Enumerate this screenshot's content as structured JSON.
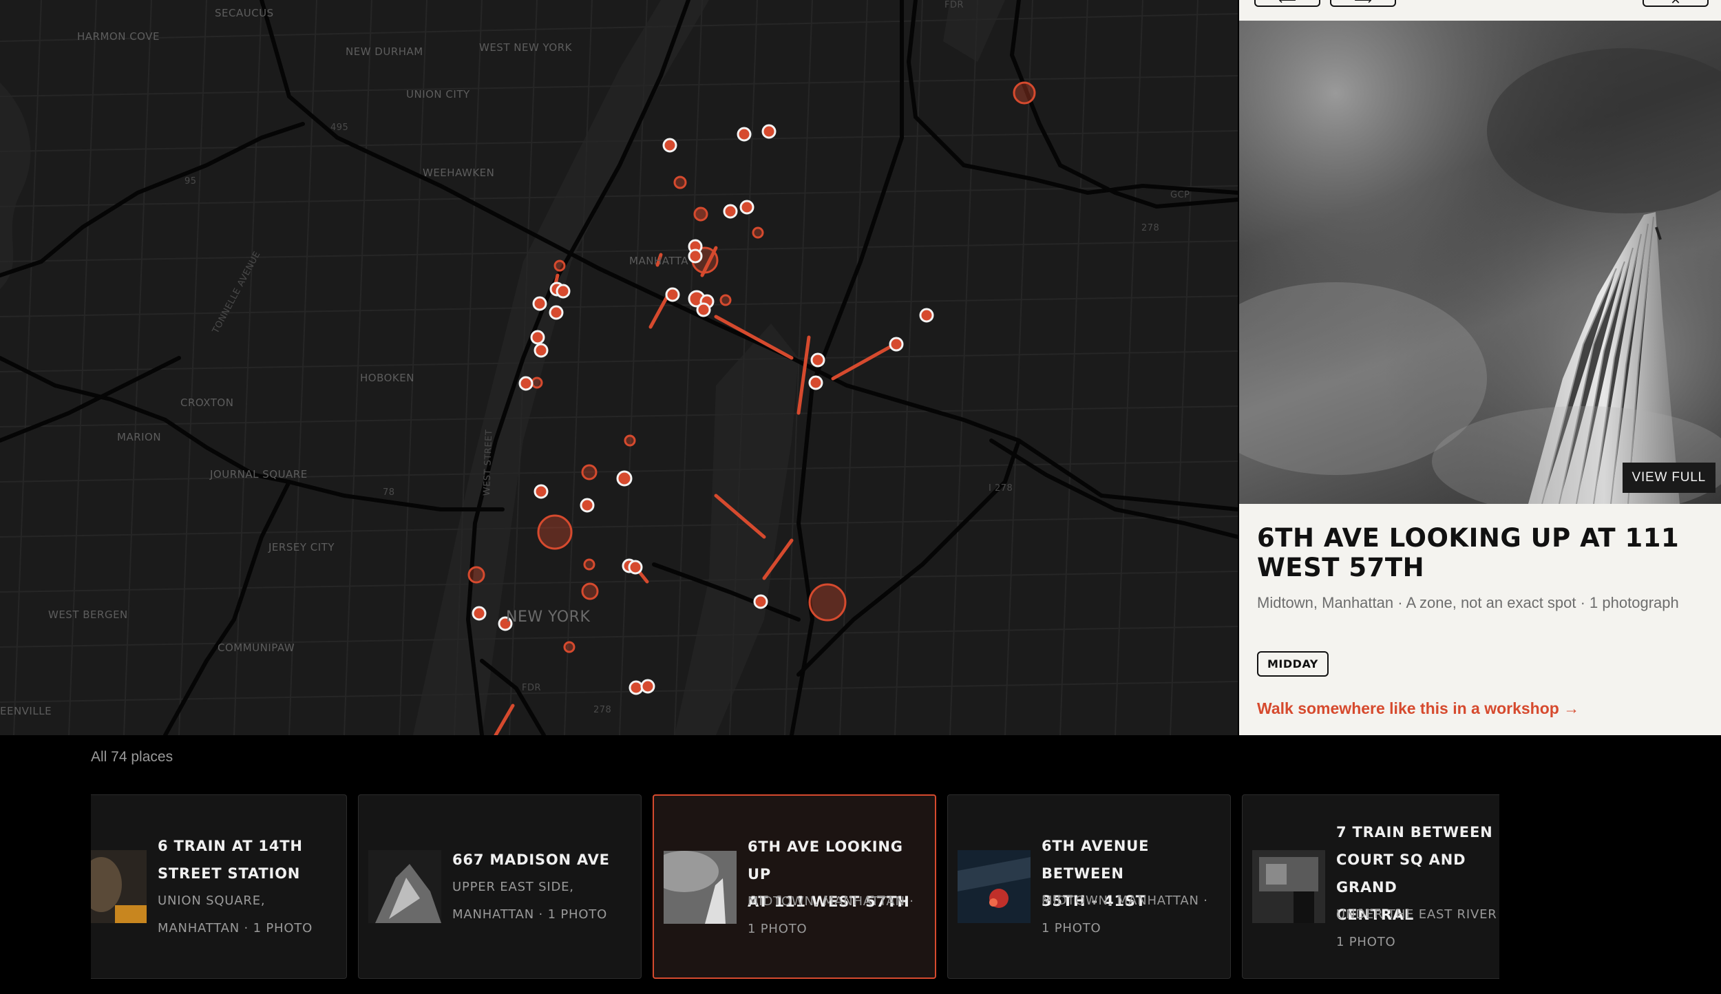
{
  "map": {
    "labels": {
      "secaucus": "SECAUCUS",
      "harmon_cove": "HARMON COVE",
      "new_durham": "NEW DURHAM",
      "west_new_york": "WEST NEW YORK",
      "union_city": "UNION CITY",
      "weehawken": "WEEHAWKEN",
      "manhattan": "MANHATTA",
      "hoboken": "HOBOKEN",
      "croxton": "CROXTON",
      "marion": "MARION",
      "journal_square": "JOURNAL SQUARE",
      "jersey_city": "JERSEY CITY",
      "west_bergen": "WEST BERGEN",
      "communipaw": "COMMUNIPAW",
      "greenville": "EENVILLE",
      "new_york": "NEW YORK",
      "fdr_top": "FDR",
      "fdr_bottom": "FDR",
      "gcp": "GCP",
      "i278": "I 278",
      "n278_right": "278",
      "n278_bottom": "278",
      "n495": "495",
      "n95": "95",
      "n78": "78",
      "west_street": "WEST STREET",
      "tonnelle": "TONNELLE AVENUE"
    },
    "accent_color": "#d64a2e"
  },
  "detail": {
    "prev_icon": "arrow-left-icon",
    "next_icon": "arrow-right-icon",
    "close_icon": "close-icon",
    "view_full_label": "VIEW FULL",
    "title": "6TH AVE LOOKING UP AT 111 WEST 57TH",
    "subtitle": "Midtown, Manhattan · A zone, not an exact spot · 1 photograph",
    "tag": "MIDDAY",
    "cta": "Walk somewhere like this in a workshop →"
  },
  "places": {
    "count_label": "All 74 places",
    "items": [
      {
        "title": "6 TRAIN AT 14TH\nSTREET STATION",
        "sub": "UNION SQUARE, MANHATTAN · 1 PHOTO",
        "active": false
      },
      {
        "title": "667 MADISON AVE",
        "sub": "UPPER EAST SIDE, MANHATTAN · 1 PHOTO",
        "active": false
      },
      {
        "title": "6TH AVE LOOKING UP\nAT 111 WEST 57TH",
        "sub": "MIDTOWN, MANHATTAN · 1 PHOTO",
        "active": true
      },
      {
        "title": "6TH AVENUE BETWEEN\n35TH - 41ST",
        "sub": "MIDTOWN, MANHATTAN · 1 PHOTO",
        "active": false
      },
      {
        "title": "7 TRAIN BETWEEN\nCOURT SQ AND GRAND\nCENTRAL",
        "sub": "UNDER THE EAST RIVER · 1 PHOTO",
        "active": false
      }
    ]
  }
}
